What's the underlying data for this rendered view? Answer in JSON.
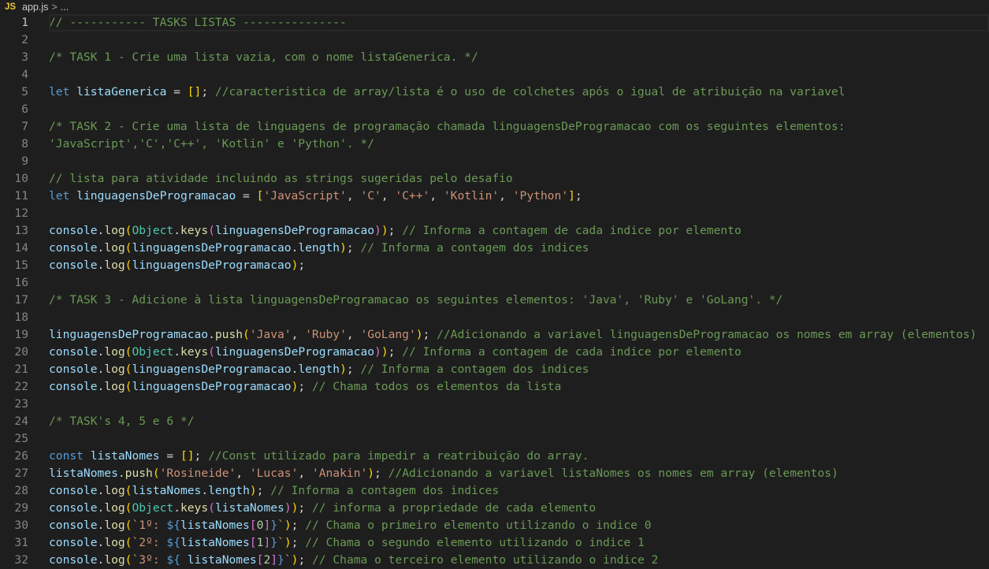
{
  "breadcrumb": {
    "icon": "JS",
    "file": "app.js",
    "separator": ">",
    "more": "..."
  },
  "active_line": 1,
  "lines": [
    [
      [
        "c",
        "// ----------- TASKS LISTAS ---------------"
      ]
    ],
    [],
    [
      [
        "c",
        "/* TASK 1 - Crie uma lista vazia, com o nome listaGenerica. */"
      ]
    ],
    [],
    [
      [
        "k",
        "let"
      ],
      [
        "p",
        " "
      ],
      [
        "v",
        "listaGenerica"
      ],
      [
        "p",
        " = "
      ],
      [
        "b1",
        "[]"
      ],
      [
        "p",
        "; "
      ],
      [
        "c",
        "//caracteristica de array/lista é o uso de colchetes após o igual de atribuição na variavel"
      ]
    ],
    [],
    [
      [
        "c",
        "/* TASK 2 - Crie uma lista de linguagens de programação chamada linguagensDeProgramacao com os seguintes elementos:"
      ]
    ],
    [
      [
        "c",
        "'JavaScript','C','C++', 'Kotlin' e 'Python'. */"
      ]
    ],
    [],
    [
      [
        "c",
        "// lista para atividade incluindo as strings sugeridas pelo desafio"
      ]
    ],
    [
      [
        "k",
        "let"
      ],
      [
        "p",
        " "
      ],
      [
        "v",
        "linguagensDeProgramacao"
      ],
      [
        "p",
        " = "
      ],
      [
        "b1",
        "["
      ],
      [
        "s",
        "'JavaScript'"
      ],
      [
        "p",
        ", "
      ],
      [
        "s",
        "'C'"
      ],
      [
        "p",
        ", "
      ],
      [
        "s",
        "'C++'"
      ],
      [
        "p",
        ", "
      ],
      [
        "s",
        "'Kotlin'"
      ],
      [
        "p",
        ", "
      ],
      [
        "s",
        "'Python'"
      ],
      [
        "b1",
        "]"
      ],
      [
        "p",
        ";"
      ]
    ],
    [],
    [
      [
        "v",
        "console"
      ],
      [
        "p",
        "."
      ],
      [
        "f",
        "log"
      ],
      [
        "b1",
        "("
      ],
      [
        "o",
        "Object"
      ],
      [
        "p",
        "."
      ],
      [
        "f",
        "keys"
      ],
      [
        "b2",
        "("
      ],
      [
        "v",
        "linguagensDeProgramacao"
      ],
      [
        "b2",
        ")"
      ],
      [
        "b1",
        ")"
      ],
      [
        "p",
        "; "
      ],
      [
        "c",
        "// Informa a contagem de cada indice por elemento"
      ]
    ],
    [
      [
        "v",
        "console"
      ],
      [
        "p",
        "."
      ],
      [
        "f",
        "log"
      ],
      [
        "b1",
        "("
      ],
      [
        "v",
        "linguagensDeProgramacao"
      ],
      [
        "p",
        "."
      ],
      [
        "v",
        "length"
      ],
      [
        "b1",
        ")"
      ],
      [
        "p",
        "; "
      ],
      [
        "c",
        "// Informa a contagem dos indices"
      ]
    ],
    [
      [
        "v",
        "console"
      ],
      [
        "p",
        "."
      ],
      [
        "f",
        "log"
      ],
      [
        "b1",
        "("
      ],
      [
        "v",
        "linguagensDeProgramacao"
      ],
      [
        "b1",
        ")"
      ],
      [
        "p",
        ";"
      ]
    ],
    [],
    [
      [
        "c",
        "/* TASK 3 - Adicione à lista linguagensDeProgramacao os seguintes elementos: 'Java', 'Ruby' e 'GoLang'. */"
      ]
    ],
    [],
    [
      [
        "v",
        "linguagensDeProgramacao"
      ],
      [
        "p",
        "."
      ],
      [
        "f",
        "push"
      ],
      [
        "b1",
        "("
      ],
      [
        "s",
        "'Java'"
      ],
      [
        "p",
        ", "
      ],
      [
        "s",
        "'Ruby'"
      ],
      [
        "p",
        ", "
      ],
      [
        "s",
        "'GoLang'"
      ],
      [
        "b1",
        ")"
      ],
      [
        "p",
        "; "
      ],
      [
        "c",
        "//Adicionando a variavel linguagensDeProgramacao os nomes em array (elementos)"
      ]
    ],
    [
      [
        "v",
        "console"
      ],
      [
        "p",
        "."
      ],
      [
        "f",
        "log"
      ],
      [
        "b1",
        "("
      ],
      [
        "o",
        "Object"
      ],
      [
        "p",
        "."
      ],
      [
        "f",
        "keys"
      ],
      [
        "b2",
        "("
      ],
      [
        "v",
        "linguagensDeProgramacao"
      ],
      [
        "b2",
        ")"
      ],
      [
        "b1",
        ")"
      ],
      [
        "p",
        "; "
      ],
      [
        "c",
        "// Informa a contagem de cada indice por elemento"
      ]
    ],
    [
      [
        "v",
        "console"
      ],
      [
        "p",
        "."
      ],
      [
        "f",
        "log"
      ],
      [
        "b1",
        "("
      ],
      [
        "v",
        "linguagensDeProgramacao"
      ],
      [
        "p",
        "."
      ],
      [
        "v",
        "length"
      ],
      [
        "b1",
        ")"
      ],
      [
        "p",
        "; "
      ],
      [
        "c",
        "// Informa a contagem dos indices"
      ]
    ],
    [
      [
        "v",
        "console"
      ],
      [
        "p",
        "."
      ],
      [
        "f",
        "log"
      ],
      [
        "b1",
        "("
      ],
      [
        "v",
        "linguagensDeProgramacao"
      ],
      [
        "b1",
        ")"
      ],
      [
        "p",
        "; "
      ],
      [
        "c",
        "// Chama todos os elementos da lista"
      ]
    ],
    [],
    [
      [
        "c",
        "/* TASK's 4, 5 e 6 */"
      ]
    ],
    [],
    [
      [
        "k",
        "const"
      ],
      [
        "p",
        " "
      ],
      [
        "v",
        "listaNomes"
      ],
      [
        "p",
        " = "
      ],
      [
        "b1",
        "[]"
      ],
      [
        "p",
        "; "
      ],
      [
        "c",
        "//Const utilizado para impedir a reatribuição do array."
      ]
    ],
    [
      [
        "v",
        "listaNomes"
      ],
      [
        "p",
        "."
      ],
      [
        "f",
        "push"
      ],
      [
        "b1",
        "("
      ],
      [
        "s",
        "'Rosineide'"
      ],
      [
        "p",
        ", "
      ],
      [
        "s",
        "'Lucas'"
      ],
      [
        "p",
        ", "
      ],
      [
        "s",
        "'Anakin'"
      ],
      [
        "b1",
        ")"
      ],
      [
        "p",
        "; "
      ],
      [
        "c",
        "//Adicionando a variavel listaNomes os nomes em array (elementos)"
      ]
    ],
    [
      [
        "v",
        "console"
      ],
      [
        "p",
        "."
      ],
      [
        "f",
        "log"
      ],
      [
        "b1",
        "("
      ],
      [
        "v",
        "listaNomes"
      ],
      [
        "p",
        "."
      ],
      [
        "v",
        "length"
      ],
      [
        "b1",
        ")"
      ],
      [
        "p",
        "; "
      ],
      [
        "c",
        "// Informa a contagem dos indices"
      ]
    ],
    [
      [
        "v",
        "console"
      ],
      [
        "p",
        "."
      ],
      [
        "f",
        "log"
      ],
      [
        "b1",
        "("
      ],
      [
        "o",
        "Object"
      ],
      [
        "p",
        "."
      ],
      [
        "f",
        "keys"
      ],
      [
        "b2",
        "("
      ],
      [
        "v",
        "listaNomes"
      ],
      [
        "b2",
        ")"
      ],
      [
        "b1",
        ")"
      ],
      [
        "p",
        "; "
      ],
      [
        "c",
        "// informa a propriedade de cada elemento"
      ]
    ],
    [
      [
        "v",
        "console"
      ],
      [
        "p",
        "."
      ],
      [
        "f",
        "log"
      ],
      [
        "b1",
        "("
      ],
      [
        "s",
        "`1º: "
      ],
      [
        "d",
        "${"
      ],
      [
        "v",
        "listaNomes"
      ],
      [
        "b2",
        "["
      ],
      [
        "n",
        "0"
      ],
      [
        "b2",
        "]"
      ],
      [
        "d",
        "}"
      ],
      [
        "s",
        "`"
      ],
      [
        "b1",
        ")"
      ],
      [
        "p",
        "; "
      ],
      [
        "c",
        "// Chama o primeiro elemento utilizando o indice 0"
      ]
    ],
    [
      [
        "v",
        "console"
      ],
      [
        "p",
        "."
      ],
      [
        "f",
        "log"
      ],
      [
        "b1",
        "("
      ],
      [
        "s",
        "`2º: "
      ],
      [
        "d",
        "${"
      ],
      [
        "v",
        "listaNomes"
      ],
      [
        "b2",
        "["
      ],
      [
        "n",
        "1"
      ],
      [
        "b2",
        "]"
      ],
      [
        "d",
        "}"
      ],
      [
        "s",
        "`"
      ],
      [
        "b1",
        ")"
      ],
      [
        "p",
        "; "
      ],
      [
        "c",
        "// Chama o segundo elemento utilizando o indice 1"
      ]
    ],
    [
      [
        "v",
        "console"
      ],
      [
        "p",
        "."
      ],
      [
        "f",
        "log"
      ],
      [
        "b1",
        "("
      ],
      [
        "s",
        "`3º: "
      ],
      [
        "d",
        "${"
      ],
      [
        "p",
        " "
      ],
      [
        "v",
        "listaNomes"
      ],
      [
        "b2",
        "["
      ],
      [
        "n",
        "2"
      ],
      [
        "b2",
        "]"
      ],
      [
        "d",
        "}"
      ],
      [
        "s",
        "`"
      ],
      [
        "b1",
        ")"
      ],
      [
        "p",
        "; "
      ],
      [
        "c",
        "// Chama o terceiro elemento utilizando o indice 2"
      ]
    ]
  ]
}
